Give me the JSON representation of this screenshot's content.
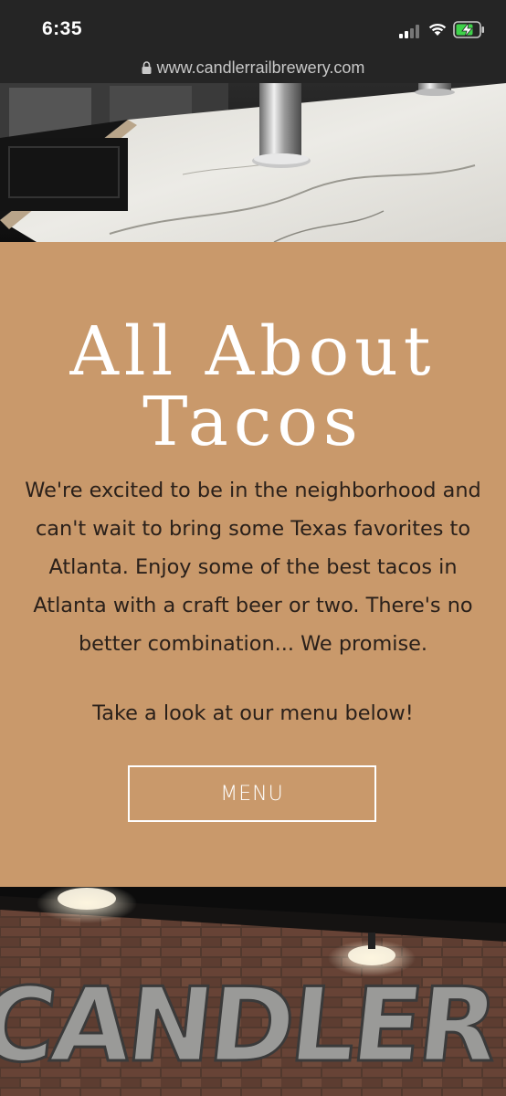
{
  "status_bar": {
    "time": "6:35",
    "icons": [
      "cellular-signal-icon",
      "wifi-icon",
      "battery-charging-icon"
    ],
    "battery_color": "#3fd24a"
  },
  "browser": {
    "url": "www.candlerrailbrewery.com",
    "lock_icon": "lock-icon"
  },
  "hero": {
    "description_icon": "bar-countertop-photo"
  },
  "section": {
    "background": "#c9996b",
    "headline_line1": "All About",
    "headline_line2": "Tacos",
    "body_lines": [
      "We're excited to be in the neighborhood and",
      "can't wait to bring some Texas favorites to",
      "Atlanta.  Enjoy some of the best tacos in",
      "Atlanta with a craft beer or two. There's no",
      "better combination... We promise."
    ],
    "cta_text": "Take a look at our menu below!",
    "menu_button_label": "MENU"
  },
  "footer_image": {
    "sign_text": "CANDLER RAIL"
  }
}
